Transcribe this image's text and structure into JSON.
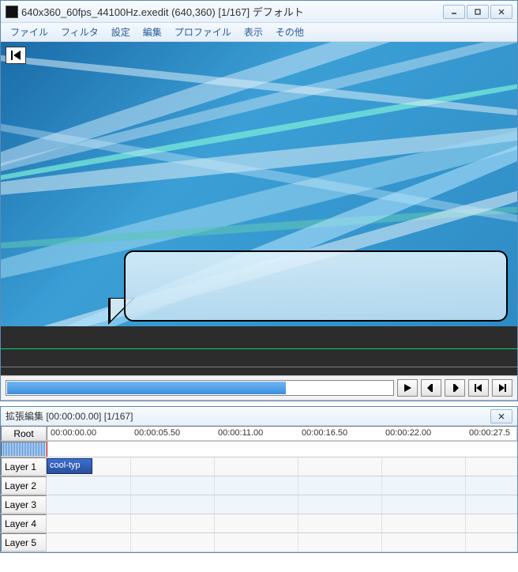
{
  "window": {
    "title": "640x360_60fps_44100Hz.exedit (640,360)  [1/167]  デフォルト"
  },
  "menu": {
    "file": "ファイル",
    "filter": "フィルタ",
    "settings": "設定",
    "edit": "編集",
    "profile": "プロファイル",
    "view": "表示",
    "other": "その他"
  },
  "timeline": {
    "title": "拡張編集 [00:00:00.00] [1/167]",
    "root": "Root",
    "ticks": [
      "00:00:00.00",
      "00:00:05.50",
      "00:00:11.00",
      "00:00:16.50",
      "00:00:22.00",
      "00:00:27.5"
    ],
    "layers": [
      "Layer 1",
      "Layer 2",
      "Layer 3",
      "Layer 4",
      "Layer 5"
    ],
    "clip1": "cool-typ"
  }
}
